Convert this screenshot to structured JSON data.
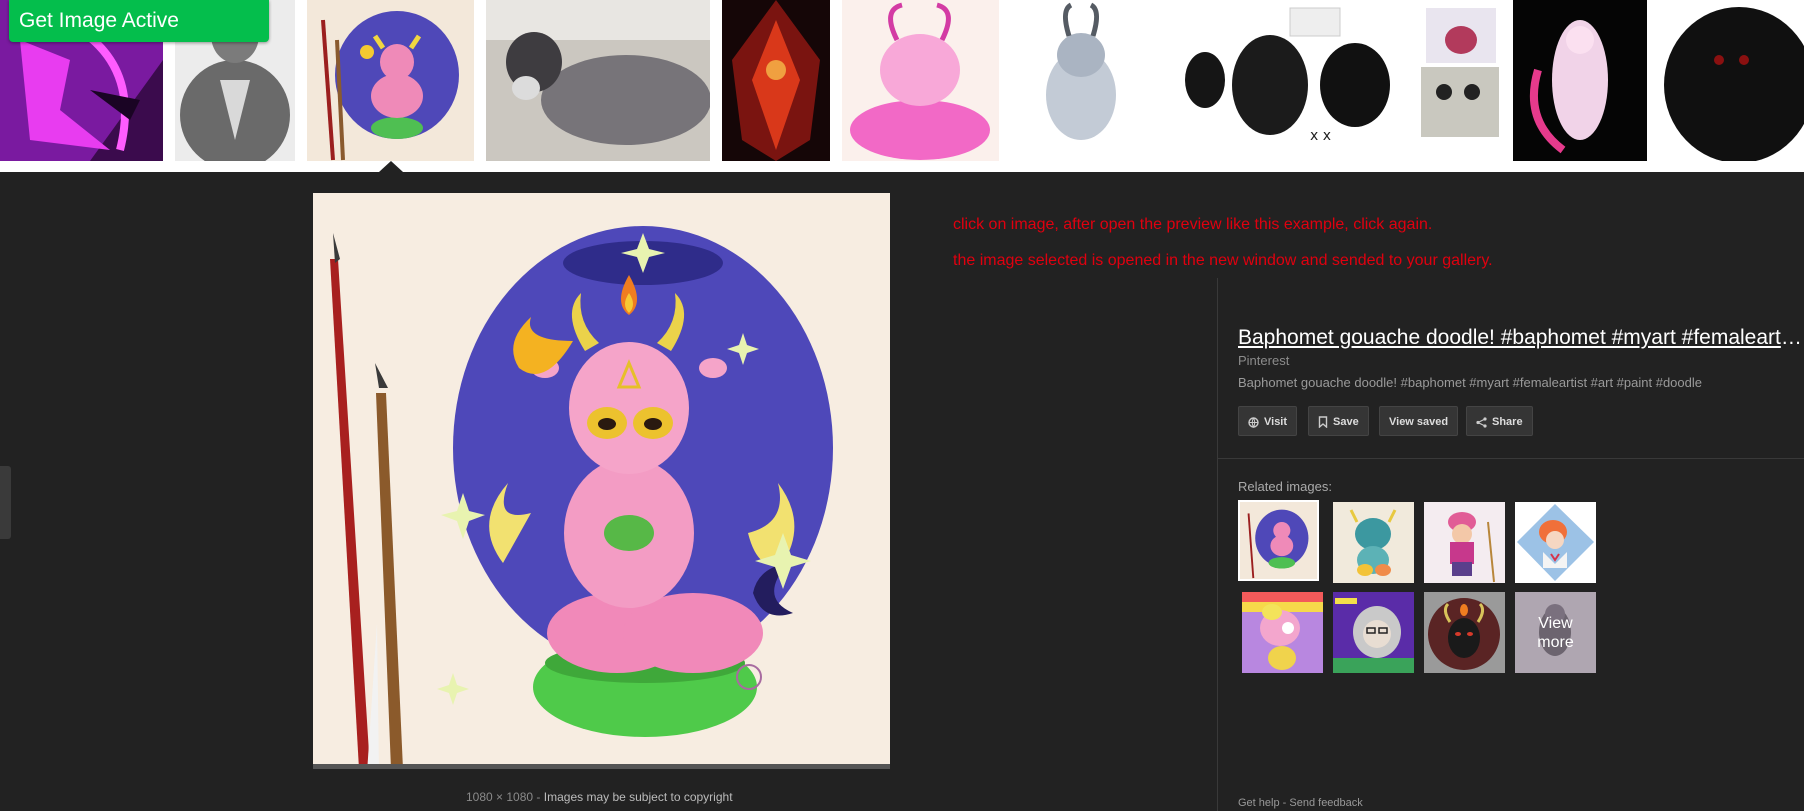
{
  "get_image_button": "Get Image Active",
  "notes": {
    "line1": "click on image, after open the preview like this example, click again.",
    "line2": "the image selected is opened in the new window and sended to your gallery."
  },
  "thumbnails": [
    {
      "subject": "purple-demon-art"
    },
    {
      "subject": "grey-werewolf-sketch"
    },
    {
      "subject": "baphomet-gouache-selected"
    },
    {
      "subject": "black-goat-photo"
    },
    {
      "subject": "red-black-demon-art"
    },
    {
      "subject": "pink-baphomet-drawing"
    },
    {
      "subject": "pale-goat-creature-drawing"
    },
    {
      "subject": "black-cat-reference-sheet"
    },
    {
      "subject": "cupcake-and-cakepop-photo"
    },
    {
      "subject": "white-demon-girl-art"
    },
    {
      "subject": "black-goat-plush"
    }
  ],
  "preview": {
    "dimensions": "1080 × 1080",
    "separator": "-",
    "copyright": "Images may be subject to copyright"
  },
  "result": {
    "title": "Baphomet gouache doodle! #baphomet #myart #femaleartist #art #paint #doodle",
    "source": "Pinterest",
    "description": "Baphomet gouache doodle! #baphomet #myart #femaleartist #art #paint #doodle"
  },
  "actions": {
    "visit": "Visit",
    "save": "Save",
    "view_saved": "View saved",
    "share": "Share"
  },
  "related": {
    "label": "Related images:",
    "view_more_line1": "View",
    "view_more_line2": "more"
  },
  "footer": {
    "help": "Get help",
    "separator": "-",
    "feedback": "Send feedback"
  }
}
